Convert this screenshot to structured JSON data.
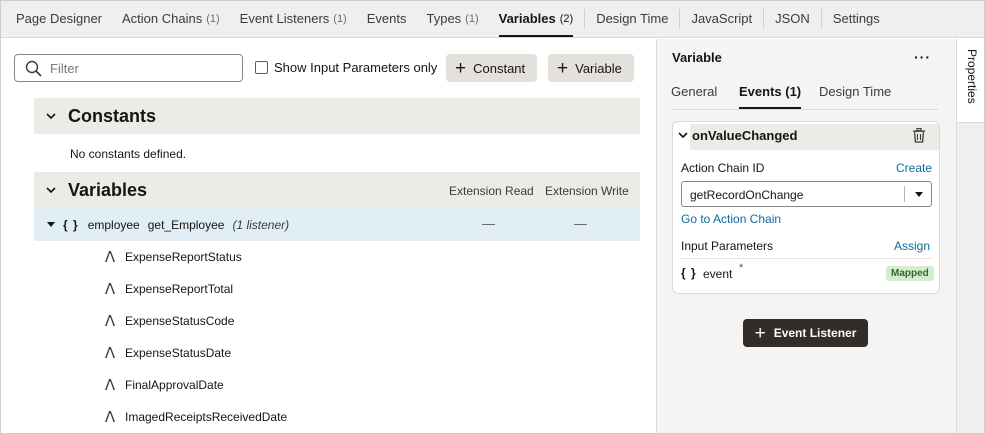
{
  "tabs": [
    {
      "label": "Page Designer",
      "count": ""
    },
    {
      "label": "Action Chains",
      "count": "(1)"
    },
    {
      "label": "Event Listeners",
      "count": "(1)"
    },
    {
      "label": "Events",
      "count": ""
    },
    {
      "label": "Types",
      "count": "(1)"
    },
    {
      "label": "Variables",
      "count": "(2)"
    },
    {
      "label": "Design Time",
      "count": ""
    },
    {
      "label": "JavaScript",
      "count": ""
    },
    {
      "label": "JSON",
      "count": ""
    },
    {
      "label": "Settings",
      "count": ""
    }
  ],
  "toolbar": {
    "filter_placeholder": "Filter",
    "show_params_label": "Show Input Parameters only",
    "constant_button": "Constant",
    "variable_button": "Variable"
  },
  "constants": {
    "title": "Constants",
    "empty_text": "No constants defined."
  },
  "variables": {
    "title": "Variables",
    "col_read": "Extension Read",
    "col_write": "Extension Write",
    "row": {
      "braces": "{ }",
      "name": "employee",
      "type": "get_Employee",
      "listeners": "(1 listener)"
    },
    "fields": [
      "ExpenseReportStatus",
      "ExpenseReportTotal",
      "ExpenseStatusCode",
      "ExpenseStatusDate",
      "FinalApprovalDate",
      "ImagedReceiptsReceivedDate"
    ]
  },
  "panel": {
    "title": "Variable",
    "more": "···",
    "tabs": {
      "general": "General",
      "events": "Events (1)",
      "design_time": "Design Time"
    },
    "event": {
      "name": "onValueChanged",
      "action_chain_label": "Action Chain ID",
      "create_link": "Create",
      "action_chain_value": "getRecordOnChange",
      "goto_link": "Go to Action Chain",
      "input_params_label": "Input Parameters",
      "assign_link": "Assign",
      "param_braces": "{ }",
      "param_name": "event",
      "param_required": "*",
      "param_status": "Mapped"
    },
    "add_listener_button": "Event Listener"
  },
  "properties_tab": "Properties"
}
